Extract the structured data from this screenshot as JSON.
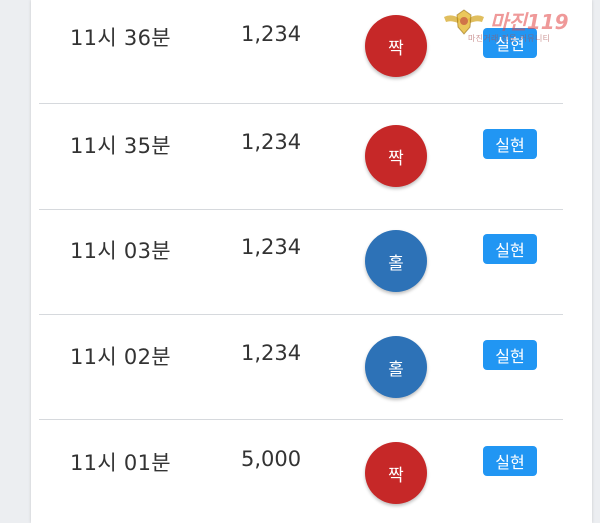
{
  "rows": [
    {
      "time": "11시 36분",
      "amount": "1,234",
      "result": "짝",
      "result_type": "jjak",
      "status": "실현"
    },
    {
      "time": "11시 35분",
      "amount": "1,234",
      "result": "짝",
      "result_type": "jjak",
      "status": "실현"
    },
    {
      "time": "11시 03분",
      "amount": "1,234",
      "result": "홀",
      "result_type": "hol",
      "status": "실현"
    },
    {
      "time": "11시 02분",
      "amount": "1,234",
      "result": "홀",
      "result_type": "hol",
      "status": "실현"
    },
    {
      "time": "11시 01분",
      "amount": "5,000",
      "result": "짝",
      "result_type": "jjak",
      "status": "실현"
    }
  ],
  "colors": {
    "jjak": "#c62828",
    "hol": "#2d72b7",
    "status_badge": "#2196f3"
  },
  "watermark": {
    "title": "마진119",
    "subtitle": "마진거래 전문 커뮤니티"
  }
}
